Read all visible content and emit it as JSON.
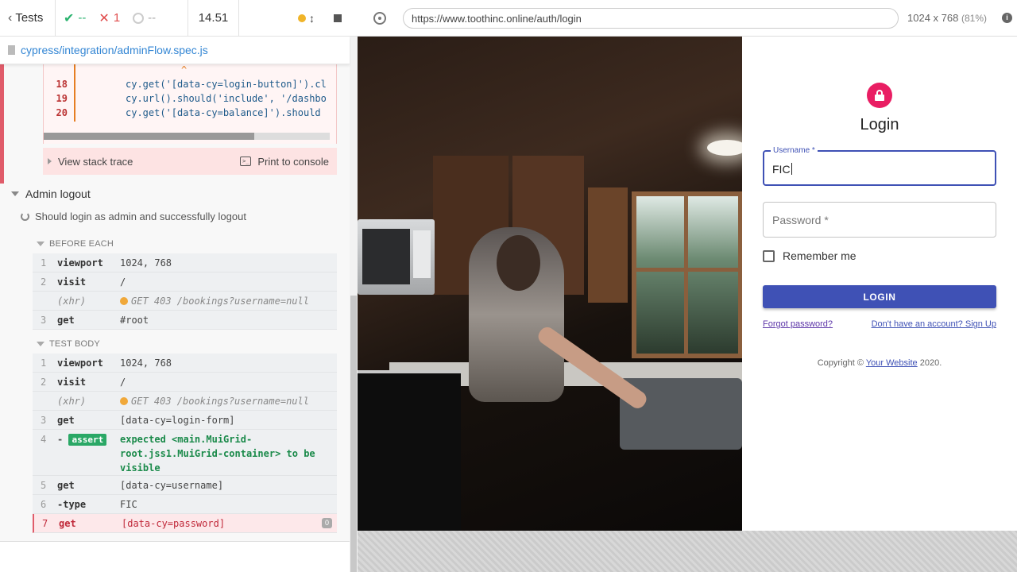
{
  "reporter": {
    "tests_label": "Tests",
    "passed": "--",
    "failed": "1",
    "pending": "--",
    "duration": "14.51",
    "spec_file": "cypress/integration/adminFlow.spec.js"
  },
  "error": {
    "caret": "^",
    "lines": [
      {
        "num": "18",
        "code": "cy.get('[data-cy=login-button]').cl"
      },
      {
        "num": "19",
        "code": "cy.url().should('include', '/dashbo"
      },
      {
        "num": "20",
        "code": "cy.get('[data-cy=balance]').should"
      }
    ],
    "view_stack": "View stack trace",
    "print_console": "Print to console",
    "console_icon_text": ">_"
  },
  "suite": {
    "title": "Admin logout",
    "test_title": "Should login as admin and successfully logout"
  },
  "before_each": {
    "label": "BEFORE EACH",
    "commands": [
      {
        "num": "1",
        "name": "viewport",
        "msg": "1024, 768",
        "kind": "normal"
      },
      {
        "num": "2",
        "name": "visit",
        "msg": "/",
        "kind": "normal"
      },
      {
        "num": "",
        "name": "(xhr)",
        "msg": "GET 403 /bookings?username=null",
        "kind": "xhr"
      },
      {
        "num": "3",
        "name": "get",
        "msg": "#root",
        "kind": "normal"
      }
    ]
  },
  "test_body": {
    "label": "TEST BODY",
    "commands": [
      {
        "num": "1",
        "name": "viewport",
        "msg": "1024, 768"
      },
      {
        "num": "2",
        "name": "visit",
        "msg": "/"
      },
      {
        "num": "",
        "name": "(xhr)",
        "msg": "GET 403 /bookings?username=null"
      },
      {
        "num": "3",
        "name": "get",
        "msg": "[data-cy=login-form]"
      },
      {
        "num": "4",
        "name": "-",
        "badge": "assert",
        "msg": "expected <main.MuiGrid-root.jss1.MuiGrid-container> to be visible"
      },
      {
        "num": "5",
        "name": "get",
        "msg": "[data-cy=username]"
      },
      {
        "num": "6",
        "name": "-type",
        "msg": "FIC"
      },
      {
        "num": "7",
        "name": "get",
        "msg": "[data-cy=password]",
        "pin": "0"
      }
    ]
  },
  "aut": {
    "url": "https://www.toothinc.online/auth/login",
    "viewport": "1024 x 768",
    "scale": "(81%)",
    "info_icon": "i"
  },
  "login": {
    "title": "Login",
    "username_label": "Username *",
    "username_value": "FIC",
    "password_placeholder": "Password *",
    "remember": "Remember me",
    "button": "LOGIN",
    "forgot": "Forgot password?",
    "signup": "Don't have an account? Sign Up",
    "copyright_prefix": "Copyright ©",
    "copyright_link": "Your Website",
    "copyright_suffix": "2020."
  },
  "colors": {
    "pass": "#2bb36f",
    "fail": "#e04b4b",
    "primary": "#3f51b5",
    "avatar": "#e91e63"
  },
  "icons": [
    "chevron-left-icon",
    "check-icon",
    "x-icon",
    "pending-icon",
    "file-icon",
    "crosshair-icon",
    "lock-icon",
    "info-icon",
    "spinner-icon"
  ]
}
